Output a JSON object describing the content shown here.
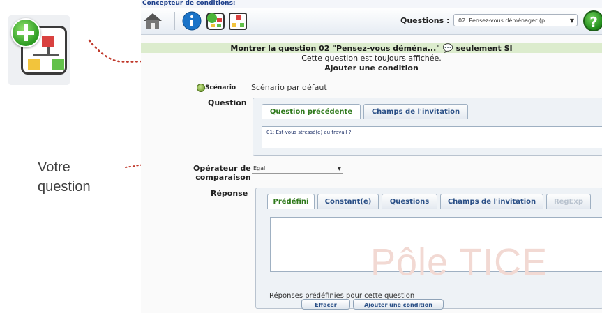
{
  "annotation": {
    "line1": "Votre",
    "line2": "question"
  },
  "app": {
    "title": "Concepteur de conditions:",
    "toolbar": {
      "questions_label": "Questions :",
      "questions_selected": "02: Pensez-vous déménager (p",
      "help_symbol": "?"
    },
    "banner": {
      "text": "Montrer la question 02 \"Pensez-vous déména...\"",
      "speech_icon": "💬",
      "suffix": "seulement SI"
    },
    "subtitle": "Cette question est toujours affichée.",
    "section_title": "Ajouter une condition",
    "scenario": {
      "label": "Scénario",
      "value": "Scénario par défaut"
    },
    "question": {
      "label": "Question",
      "tabs": [
        "Question précédente",
        "Champs de l'invitation"
      ],
      "selected_text": "01: Est-vous stressé(e) au travail ?"
    },
    "operator": {
      "label_line1": "Opérateur de",
      "label_line2": "comparaison",
      "value": "Égal"
    },
    "response": {
      "label": "Réponse",
      "tabs": [
        "Prédéfini",
        "Constant(e)",
        "Questions",
        "Champs de l'invitation",
        "RegExp"
      ],
      "footer": "Réponses prédéfinies pour cette question"
    },
    "buttons": {
      "clear": "Effacer",
      "add": "Ajouter une condition"
    },
    "watermark": "Pôle TICE"
  },
  "icons": [
    "add-condition-icon",
    "home-icon",
    "info-icon",
    "add-question-icon",
    "condition-icon",
    "help-icon",
    "scenario-icon",
    "chevron-down-icon",
    "speech-bubble-icon"
  ]
}
